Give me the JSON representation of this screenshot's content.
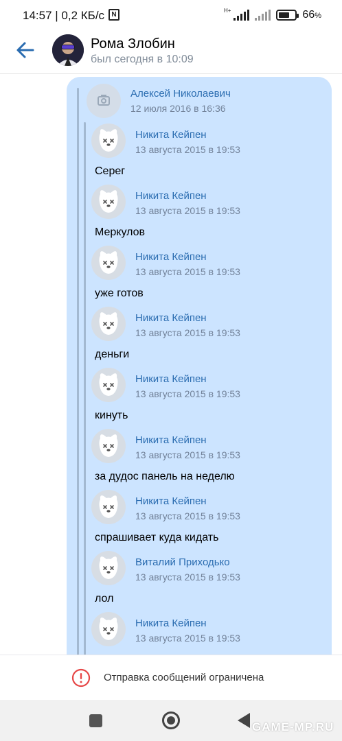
{
  "status_bar": {
    "time_speed": "14:57 | 0,2 КБ/с",
    "nfc_icon": "nfc-icon",
    "network": "H+",
    "battery_percent": "66",
    "battery_symbol": "%",
    "battery_level": 0.66
  },
  "header": {
    "contact_name": "Рома Злобин",
    "last_seen": "был сегодня в 10:09"
  },
  "forward_root": {
    "author": "Алексей Николаевич",
    "date": "12 июля 2016 в 16:36"
  },
  "messages": [
    {
      "author": "Никита Кейпен",
      "date": "13 августа 2015 в 19:53",
      "text": "Серег"
    },
    {
      "author": "Никита Кейпен",
      "date": "13 августа 2015 в 19:53",
      "text": "Меркулов"
    },
    {
      "author": "Никита Кейпен",
      "date": "13 августа 2015 в 19:53",
      "text": "уже готов"
    },
    {
      "author": "Никита Кейпен",
      "date": "13 августа 2015 в 19:53",
      "text": "деньги"
    },
    {
      "author": "Никита Кейпен",
      "date": "13 августа 2015 в 19:53",
      "text": "кинуть"
    },
    {
      "author": "Никита Кейпен",
      "date": "13 августа 2015 в 19:53",
      "text": "за дудос панель на неделю"
    },
    {
      "author": "Никита Кейпен",
      "date": "13 августа 2015 в 19:53",
      "text": "спрашивает куда кидать"
    },
    {
      "author": "Виталий Приходько",
      "date": "13 августа 2015 в 19:53",
      "text": "лол"
    },
    {
      "author": "Никита Кейпен",
      "date": "13 августа 2015 в 19:53",
      "text": ""
    }
  ],
  "footer": {
    "restricted_text": "Отправка сообщений ограничена"
  },
  "watermark": "GAME-MP.RU",
  "colors": {
    "accent": "#2a6cb0",
    "bubble": "#cce4ff",
    "secondary_text": "#818c99",
    "error": "#e64646"
  }
}
